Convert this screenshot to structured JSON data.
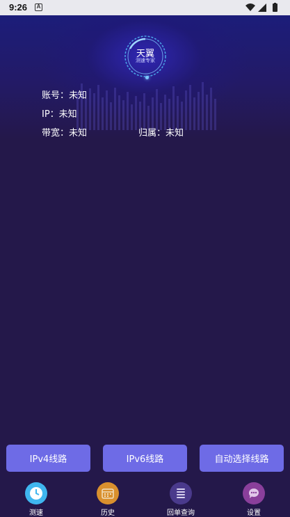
{
  "status_bar": {
    "time": "9:26",
    "notification_icon": "A"
  },
  "logo": {
    "title": "天翼",
    "subtitle": "测速专家"
  },
  "info": {
    "account": "账号：未知",
    "ip": "IP：未知",
    "bandwidth": "带宽：未知",
    "location": "归属：未知"
  },
  "buttons": {
    "ipv4": "IPv4线路",
    "ipv6": "IPv6线路",
    "auto": "自动选择线路"
  },
  "nav": [
    {
      "label": "测速",
      "icon": "clock-icon",
      "color": "#3fb6ef"
    },
    {
      "label": "历史",
      "icon": "calendar-icon",
      "color": "#d9902e"
    },
    {
      "label": "回单查询",
      "icon": "list-icon",
      "color": "#4a3a8c"
    },
    {
      "label": "设置",
      "icon": "chat-icon",
      "color": "#8a3f9b"
    }
  ]
}
